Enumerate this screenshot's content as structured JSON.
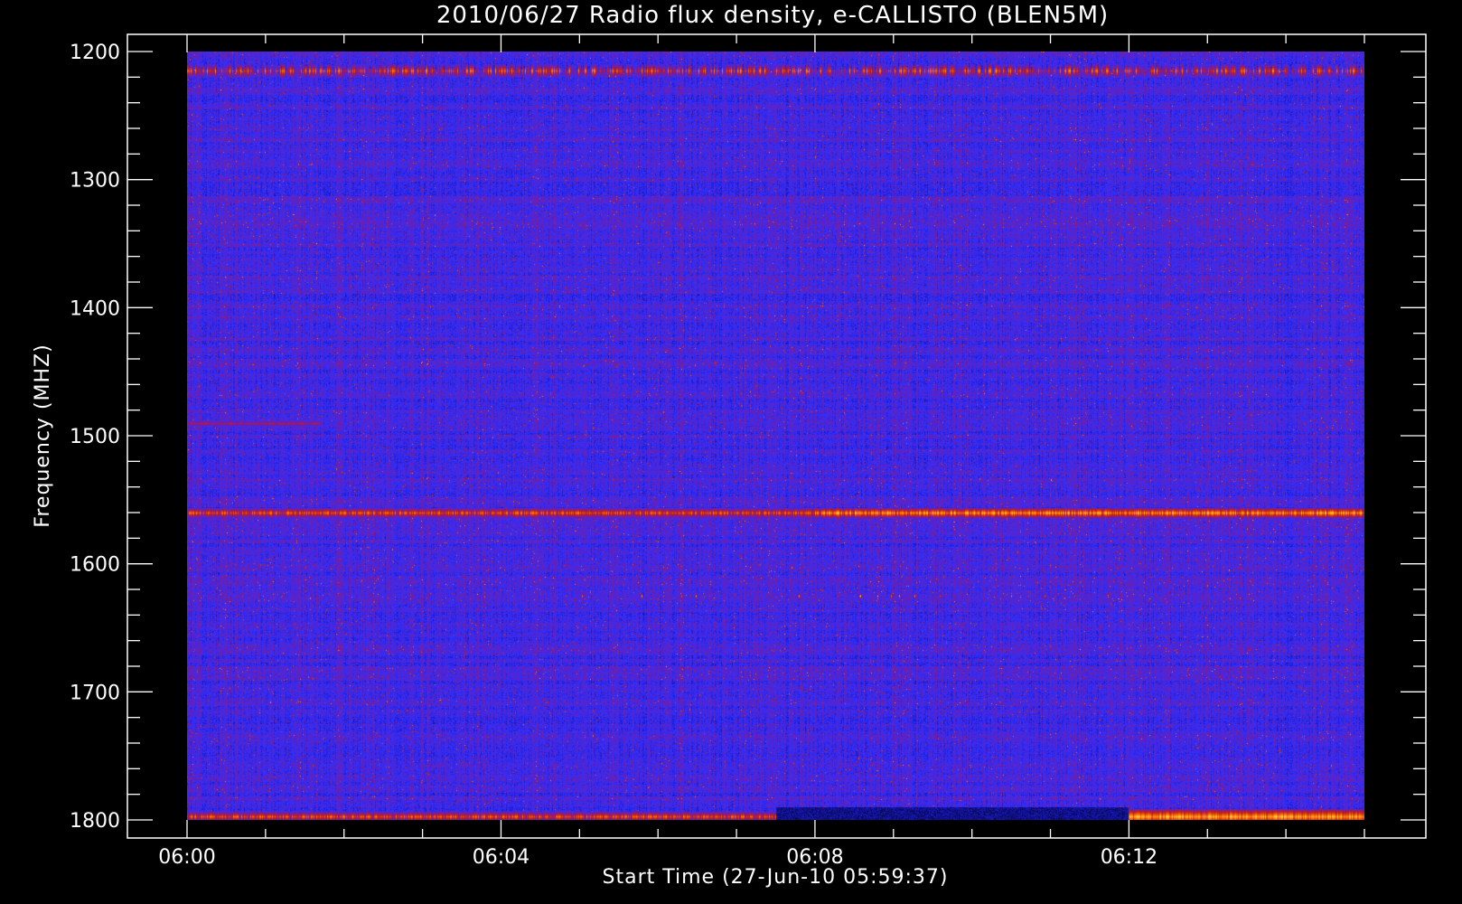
{
  "chart_data": {
    "type": "heatmap",
    "title": "2010/06/27  Radio flux density, e-CALLISTO (BLEN5M)",
    "xlabel": "Start Time (27-Jun-10 05:59:37)",
    "ylabel": "Frequency (MHZ)",
    "x_ticks": [
      "06:00",
      "06:04",
      "06:08",
      "06:12"
    ],
    "x_tick_minutes": [
      0,
      4,
      8,
      12
    ],
    "x_range_minutes": [
      0,
      15
    ],
    "y_ticks": [
      1200,
      1300,
      1400,
      1500,
      1600,
      1700,
      1800
    ],
    "y_range": [
      1200,
      1800
    ],
    "y_inverted": true,
    "grid": false,
    "background_color": "#000000",
    "colormap": [
      "#000000",
      "#1818c8",
      "#3030ff",
      "#7a1aa0",
      "#c0201a",
      "#ff6a00",
      "#ffd23c",
      "#ffffff"
    ],
    "features": [
      {
        "freq_mhz": 1215,
        "start_min": 0,
        "end_min": 15,
        "intensity": "high, intermittent"
      },
      {
        "freq_mhz": 1490,
        "start_min": 0,
        "end_min": 1.7,
        "intensity": "moderate"
      },
      {
        "freq_mhz": 1560,
        "start_min": 0,
        "end_min": 15,
        "intensity": "high, stronger after 06:08"
      },
      {
        "freq_mhz": 1625,
        "start_min": 5,
        "end_min": 11,
        "intensity": "sparse spikes"
      },
      {
        "freq_mhz": 1797,
        "start_min": 0,
        "end_min": 7.5,
        "intensity": "high"
      },
      {
        "freq_mhz": 1797,
        "start_min": 12,
        "end_min": 15,
        "intensity": "very high"
      }
    ]
  }
}
